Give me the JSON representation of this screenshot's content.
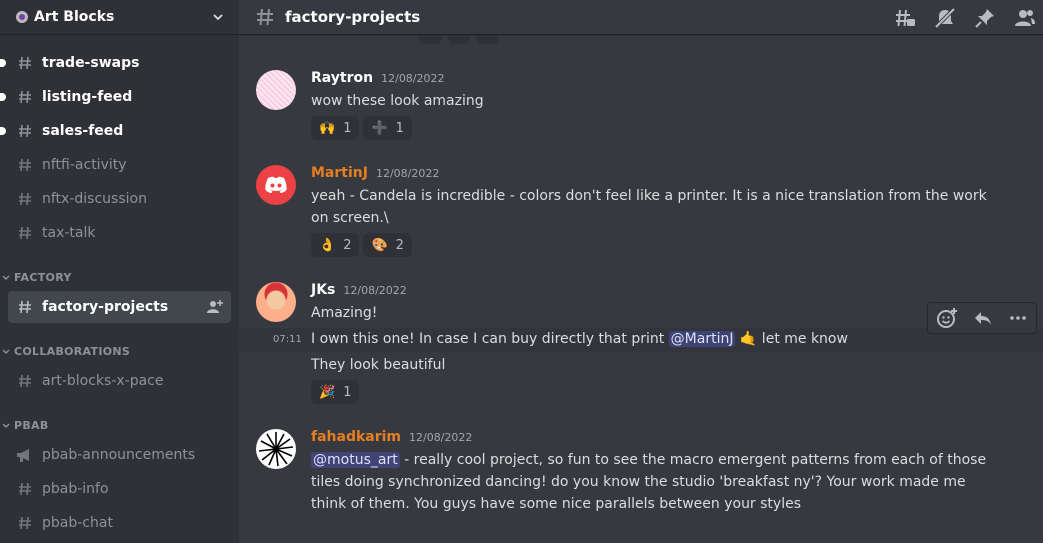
{
  "server": {
    "name": "Art Blocks"
  },
  "channels": [
    {
      "name": "trade-swaps",
      "state": "unread"
    },
    {
      "name": "listing-feed",
      "state": "unread"
    },
    {
      "name": "sales-feed",
      "state": "unread"
    },
    {
      "name": "nftfi-activity",
      "state": "normal"
    },
    {
      "name": "nftx-discussion",
      "state": "normal"
    },
    {
      "name": "tax-talk",
      "state": "normal"
    }
  ],
  "categories": {
    "factory": {
      "label": "FACTORY",
      "channels": [
        {
          "name": "factory-projects",
          "state": "active"
        }
      ]
    },
    "collaborations": {
      "label": "COLLABORATIONS",
      "channels": [
        {
          "name": "art-blocks-x-pace",
          "state": "normal"
        }
      ]
    },
    "pbab": {
      "label": "PBAB",
      "channels": [
        {
          "name": "pbab-announcements",
          "icon": "megaphone-icon"
        },
        {
          "name": "pbab-info",
          "icon": "hash-icon"
        },
        {
          "name": "pbab-chat",
          "icon": "hash-icon"
        }
      ]
    }
  },
  "topbar": {
    "channel": "factory-projects",
    "icons": [
      "threads-icon",
      "mute-icon",
      "pin-icon",
      "members-icon"
    ]
  },
  "messages": [
    {
      "author": "Raytron",
      "timestamp": "12/08/2022",
      "text": "wow these look amazing",
      "reactions": [
        {
          "emoji": "🙌",
          "count": "1"
        },
        {
          "emoji": "➕",
          "count": "1"
        }
      ]
    },
    {
      "author": "MartinJ",
      "timestamp": "12/08/2022",
      "text": "yeah - Candela is incredible - colors don't feel like a printer. It is a nice translation from the work on screen.\\",
      "reactions": [
        {
          "emoji": "👌",
          "count": "2"
        },
        {
          "emoji": "🎨",
          "count": "2"
        }
      ]
    },
    {
      "author": "JKs",
      "timestamp": "12/08/2022",
      "lines": [
        {
          "text": "Amazing!"
        },
        {
          "time": "07:11",
          "before": "I own this one! In case I can buy directly that print ",
          "mention": "@MartinJ",
          "emoji": "🤙",
          "after": " let me know"
        },
        {
          "text": "They look beautiful"
        }
      ],
      "reactions": [
        {
          "emoji": "🎉",
          "count": "1"
        }
      ]
    },
    {
      "author": "fahadkarim",
      "timestamp": "12/08/2022",
      "mention": "@motus_art",
      "text": " - really cool project, so fun to see the macro emergent patterns from each of those tiles doing synchronized dancing! do you know the studio 'breakfast ny'? Your work made me think of them. You guys have some nice parallels between your styles"
    }
  ],
  "colors": {
    "sidebar": "#2f3136",
    "chat": "#36393f",
    "mention": "#5865f2",
    "orange_name": "#e67e22"
  }
}
